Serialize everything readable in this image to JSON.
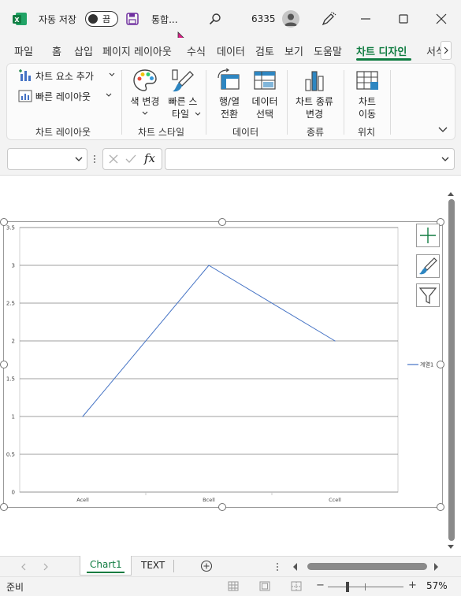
{
  "titlebar": {
    "autosave_label": "자동 저장",
    "toggle_state": "끔",
    "file_name": "통합...",
    "user_id": "6335"
  },
  "tabs": [
    "파일",
    "홈",
    "삽입",
    "페이지 레이아웃",
    "수식",
    "데이터",
    "검토",
    "보기",
    "도움말",
    "차트 디자인",
    "서식"
  ],
  "ribbon": {
    "add_element": "차트 요소 추가",
    "quick_layout": "빠른 레이아웃",
    "group_layout": "차트 레이아웃",
    "change_color_1": "색 변경",
    "quick_style_1": "빠른 스",
    "quick_style_2": "타일",
    "group_style": "차트 스타일",
    "switch_1": "행/열",
    "switch_2": "전환",
    "select_1": "데이터",
    "select_2": "선택",
    "group_data": "데이터",
    "change_type_1": "차트 종류",
    "change_type_2": "변경",
    "group_type": "종류",
    "move_1": "차트",
    "move_2": "이동",
    "group_location": "위치"
  },
  "formula": {
    "name_box": "",
    "fx": "fx",
    "content": ""
  },
  "chart_data": {
    "type": "line",
    "categories": [
      "Acell",
      "Bcell",
      "Ccell"
    ],
    "series": [
      {
        "name": "계열1",
        "values": [
          1,
          3,
          2
        ],
        "color": "#4472c4"
      }
    ],
    "y_ticks": [
      "0",
      "0.5",
      "1",
      "1.5",
      "2",
      "2.5",
      "3",
      "3.5"
    ],
    "ylim": [
      0,
      3.5
    ],
    "grid": true,
    "legend": "right"
  },
  "sheet_tabs": [
    "Chart1",
    "TEXT"
  ],
  "status": {
    "ready": "준비",
    "zoom": "57%",
    "minus": "−",
    "plus": "+"
  },
  "colors": {
    "accent": "#107c41",
    "series": "#4472c4"
  }
}
